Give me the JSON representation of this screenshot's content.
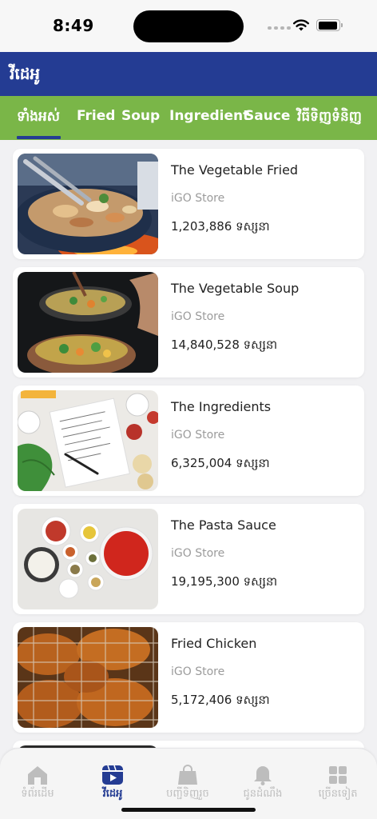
{
  "status": {
    "time": "8:49"
  },
  "header": {
    "title": "វីដេអូ"
  },
  "tabs": [
    {
      "label": "ទាំងអស់",
      "active": true
    },
    {
      "label": "Fried"
    },
    {
      "label": "Soup"
    },
    {
      "label": "Ingredient"
    },
    {
      "label": "Sauce"
    },
    {
      "label": "វិធីទិញទំនិញ"
    }
  ],
  "videos": [
    {
      "title": "The Vegetable Fried",
      "store": "iGO Store",
      "views": "1,203,886 ទស្សនា",
      "thumbnail": "fried-vegetables-pan-image"
    },
    {
      "title": "The Vegetable Soup",
      "store": "iGO Store",
      "views": "14,840,528 ទស្សនា",
      "thumbnail": "vegetable-soup-pot-image"
    },
    {
      "title": "The Ingredients",
      "store": "iGO Store",
      "views": "6,325,004 ទស្សនា",
      "thumbnail": "ingredients-notebook-image"
    },
    {
      "title": "The Pasta Sauce",
      "store": "iGO Store",
      "views": "19,195,300 ទស្សនា",
      "thumbnail": "pasta-sauce-bowls-image"
    },
    {
      "title": "Fried Chicken",
      "store": "iGO Store",
      "views": "5,172,406 ទស្សនា",
      "thumbnail": "fried-chicken-rack-image"
    }
  ],
  "bottom_nav": [
    {
      "label": "ទំព័រដើម",
      "icon": "home-icon"
    },
    {
      "label": "វីដេអូ",
      "icon": "video-icon",
      "active": true
    },
    {
      "label": "បញ្ជីទិញរួច",
      "icon": "shopping-bag-icon"
    },
    {
      "label": "ជូនដំណឹង",
      "icon": "bell-icon"
    },
    {
      "label": "ច្រើនទៀត",
      "icon": "grid-icon"
    }
  ],
  "colors": {
    "header": "#243c93",
    "tabs": "#7ab648",
    "inactive_nav": "#bdbdbd"
  }
}
